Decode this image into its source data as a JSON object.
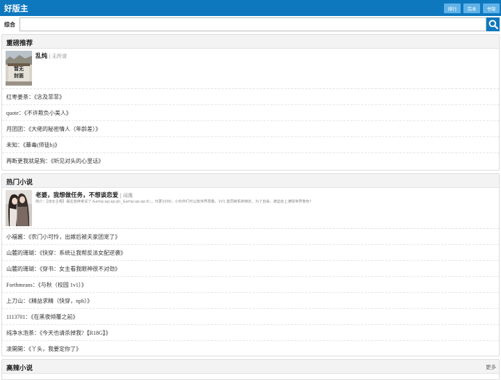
{
  "header": {
    "logo": "好版主",
    "buttons": [
      "排行",
      "完本",
      "书架"
    ]
  },
  "search": {
    "label": "综合",
    "placeholder": ""
  },
  "sections": [
    {
      "title": "重磅推荐",
      "feature": {
        "title": "乱炖",
        "author": "无所谓",
        "desc": "",
        "cover_text": "暂无封面"
      },
      "items": [
        "红枣姜茶：《念及菲菲》",
        "quote：《不许欺负小美人》",
        "月团团：《大佬的秘密情人（年龄差）》",
        "未知：《蘼毒(师徒h)》",
        "再断更我就是狗：《听见对头的心里话》"
      ]
    },
    {
      "title": "热门小说",
      "feature": {
        "title": "老婆，我想做任务，不想谈恋爱",
        "author": "闻鹰",
        "desc": "简介：【双女主嗯】最近连续考试了;&amp;ap;ap;gt;_&amp;ap;ap;lt;;，日更1000，小伙伴们可以放世界再看。1V1 蓝同被系统绑定，为了自由，被迫走上满球世界角色?",
        "cover_text": ""
      },
      "items": [
        "小福酱：《农门小可怜，出嫁后被夫家团宠了》",
        "山麓的珊瑚：《快穿：系统让我帮反派女配逆袭》",
        "山麓的珊瑚：《穿书：女主看我眼神很不对劲》",
        "Forthmeans：《与秋（校园 1v1）》",
        "上刀山：《精益求精（快穿，nph）》",
        "1113701：《在黑夜倾覆之前》",
        "纯净水泡茶：《今天也请杀掉我?【R18G】》",
        "凌開開：《丫头，我要定你了》"
      ]
    },
    {
      "title": "高辣小说",
      "more": "更多"
    }
  ],
  "colors": {
    "brand": "#0e78bf",
    "button": "#5fb2e8",
    "section_header": "#f3f3f3"
  }
}
